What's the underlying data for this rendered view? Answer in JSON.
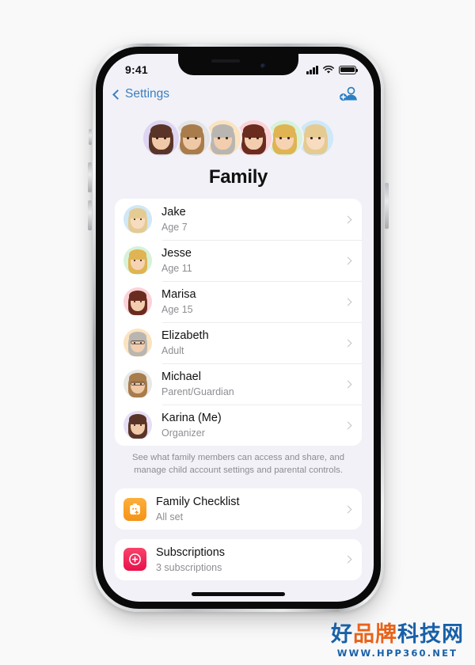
{
  "status_bar": {
    "time": "9:41",
    "signal_icon": "cellular-bars-icon",
    "wifi_icon": "wifi-icon",
    "battery_icon": "battery-icon"
  },
  "nav": {
    "back_label": "Settings",
    "back_icon": "chevron-left-icon",
    "add_icon": "add-person-icon"
  },
  "header": {
    "title": "Family"
  },
  "avatar_cluster": [
    {
      "name": "Karina",
      "bg": "#ded5f2",
      "hair": "#5a3527",
      "skin": "#f0c9a8"
    },
    {
      "name": "Michael",
      "bg": "#e4e4e6",
      "hair": "#a97c4c",
      "skin": "#efc8a5"
    },
    {
      "name": "Elizabeth",
      "bg": "#fbe3c0",
      "hair": "#b9b6b2",
      "skin": "#f2cdae"
    },
    {
      "name": "Marisa",
      "bg": "#fbd2d7",
      "hair": "#6b2c20",
      "skin": "#f3cdad"
    },
    {
      "name": "Jesse",
      "bg": "#d6f2d9",
      "hair": "#e0b452",
      "skin": "#f6d3b3"
    },
    {
      "name": "Jake",
      "bg": "#cfe8f7",
      "hair": "#e5cb92",
      "skin": "#f7dcc0"
    }
  ],
  "members": [
    {
      "name": "Jake",
      "role": "Age 7",
      "bg": "#cfe8f7",
      "hair": "#e5cb92",
      "skin": "#f7dcc0",
      "glasses": false
    },
    {
      "name": "Jesse",
      "role": "Age 11",
      "bg": "#d6f2d9",
      "hair": "#e0b452",
      "skin": "#f6d3b3",
      "glasses": false
    },
    {
      "name": "Marisa",
      "role": "Age 15",
      "bg": "#fbd2d7",
      "hair": "#6b2c20",
      "skin": "#f3cdad",
      "glasses": false
    },
    {
      "name": "Elizabeth",
      "role": "Adult",
      "bg": "#fbe3c0",
      "hair": "#b9b6b2",
      "skin": "#f2cdae",
      "glasses": true
    },
    {
      "name": "Michael",
      "role": "Parent/Guardian",
      "bg": "#e9e7e4",
      "hair": "#a97c4c",
      "skin": "#efc8a5",
      "glasses": true
    },
    {
      "name": "Karina (Me)",
      "role": "Organizer",
      "bg": "#e6def5",
      "hair": "#5a3527",
      "skin": "#f0c9a8",
      "glasses": false
    }
  ],
  "footnote": "See what family members can access and share, and manage child account settings and parental controls.",
  "services": [
    {
      "name": "Family Checklist",
      "sub": "All set",
      "icon": "checklist-icon",
      "color": "#f59316"
    },
    {
      "name": "Subscriptions",
      "sub": "3 subscriptions",
      "icon": "app-store-icon",
      "color": "#e8114b"
    }
  ],
  "watermark": {
    "cn_blue_1": "好",
    "cn_orange": "品牌",
    "cn_blue_2": "科技网",
    "url": "WWW.HPP360.NET"
  }
}
